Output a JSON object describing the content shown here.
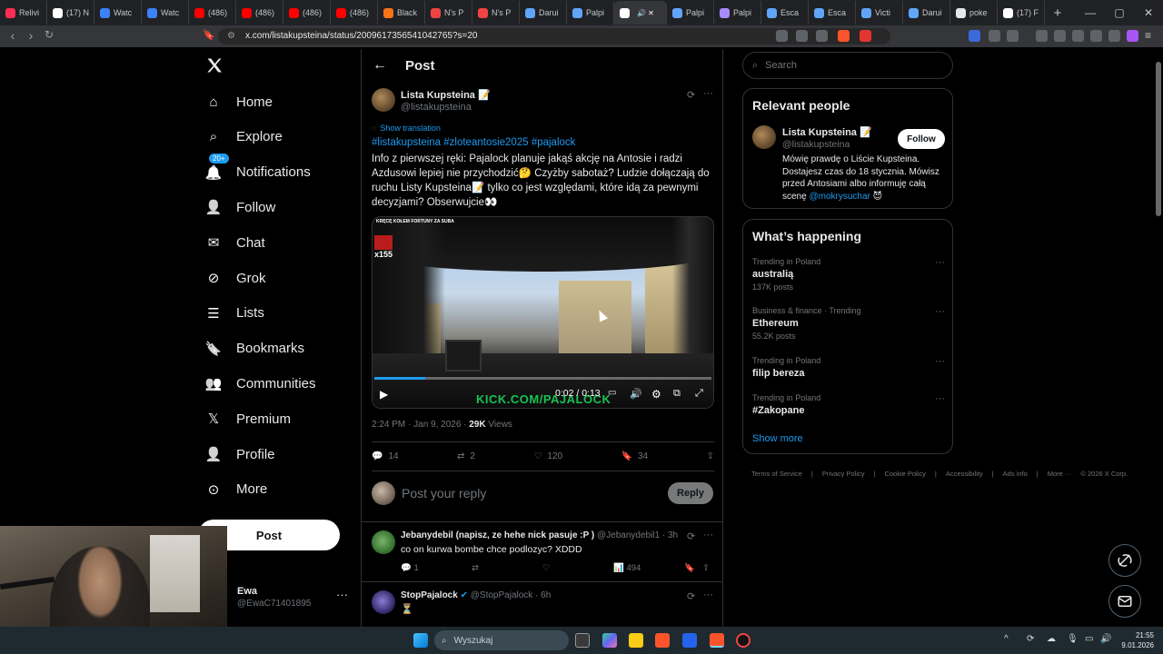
{
  "browser": {
    "tabs": [
      {
        "label": "Relivi",
        "color": "#ff2d55"
      },
      {
        "label": "(17) N",
        "color": "#ffffff"
      },
      {
        "label": "Watc",
        "color": "#3b82f6"
      },
      {
        "label": "Watc",
        "color": "#3b82f6"
      },
      {
        "label": "(486)",
        "color": "#ff0000"
      },
      {
        "label": "(486)",
        "color": "#ff0000"
      },
      {
        "label": "(486)",
        "color": "#ff0000"
      },
      {
        "label": "(486)",
        "color": "#ff0000"
      },
      {
        "label": "Black",
        "color": "#f97316"
      },
      {
        "label": "N's P",
        "color": "#ef4444"
      },
      {
        "label": "N's P",
        "color": "#ef4444"
      },
      {
        "label": "Darui",
        "color": "#60a5fa"
      },
      {
        "label": "Palpi",
        "color": "#60a5fa"
      },
      {
        "label": "",
        "color": "#ffffff"
      },
      {
        "label": "Palpi",
        "color": "#60a5fa"
      },
      {
        "label": "Palpi",
        "color": "#a78bfa"
      },
      {
        "label": "Esca",
        "color": "#60a5fa"
      },
      {
        "label": "Esca",
        "color": "#60a5fa"
      },
      {
        "label": "Victi",
        "color": "#60a5fa"
      },
      {
        "label": "Darui",
        "color": "#60a5fa"
      },
      {
        "label": "poke",
        "color": "#e5e7eb"
      },
      {
        "label": "(17) F",
        "color": "#ffffff"
      }
    ],
    "url": "x.com/listakupsteina/status/2009617356541042765?s=20"
  },
  "nav": {
    "items": [
      {
        "label": "Home",
        "icon": "home-icon"
      },
      {
        "label": "Explore",
        "icon": "search-icon"
      },
      {
        "label": "Notifications",
        "icon": "bell-icon"
      },
      {
        "label": "Follow",
        "icon": "add-person-icon"
      },
      {
        "label": "Chat",
        "icon": "mail-icon"
      },
      {
        "label": "Grok",
        "icon": "grok-icon"
      },
      {
        "label": "Lists",
        "icon": "list-icon"
      },
      {
        "label": "Bookmarks",
        "icon": "bookmark-icon"
      },
      {
        "label": "Communities",
        "icon": "communities-icon"
      },
      {
        "label": "Premium",
        "icon": "x-icon"
      },
      {
        "label": "Profile",
        "icon": "person-icon"
      },
      {
        "label": "More",
        "icon": "more-circle-icon"
      }
    ],
    "notifications_badge": "20+",
    "post_label": "Post",
    "user": {
      "name": "Ewa",
      "handle": "@EwaC71401895"
    }
  },
  "main": {
    "header_title": "Post",
    "tweet": {
      "author_name": "Lista Kupsteina 📝",
      "author_handle": "@listakupsteina",
      "show_translation": "Show translation",
      "hashtags": "#listakupsteina #zloteantosie2025 #pajalock",
      "text": "Info z pierwszej ręki: Pajalock planuje jakąś akcję na Antosie i radzi Azdusowi lepiej nie przychodzić🤔 Czyżby sabotaż? Ludzie dołączają do ruchu Listy Kupsteina📝 tylko co jest względami, które idą za pewnymi decyzjami? Obserwujcie👀",
      "video": {
        "overlay_text": "KRĘCĘ KOŁEM FORTUNY ZA SUBA",
        "overlay_count": "x155",
        "watermark": "KICK.COM/PAJALOCK",
        "time": "0:02 / 0:13",
        "progress": 0.15
      },
      "timestamp": "2:24 PM · Jan 9, 2026 · ",
      "views": "29K",
      "views_label": " Views",
      "stats": {
        "replies": "14",
        "reposts": "2",
        "likes": "120",
        "bookmarks": "34"
      }
    },
    "reply_placeholder": "Post your reply",
    "reply_button": "Reply",
    "replies": [
      {
        "name": "Jebanydebil (napisz, ze hehe nick pasuje :P )",
        "handle": "@Jebanydebil1 · 3h",
        "text": "co on kurwa bombe chce podlozyc? XDDD",
        "replies": "1",
        "views": "494"
      },
      {
        "name": "StopPajalock",
        "handle": "@StopPajalock · 6h",
        "text": "⏳"
      }
    ]
  },
  "right": {
    "search_placeholder": "Search",
    "relevant_title": "Relevant people",
    "relevant": {
      "name": "Lista Kupsteina 📝",
      "handle": "@listakupsteina",
      "follow_label": "Follow",
      "bio": "Mówię prawdę o Liście Kupsteina. Dostajesz czas do 18 stycznia. Mówisz przed Antosiami albo informuję całą scenę ",
      "bio_mention": "@mokrysuchar",
      "bio_end": " 😈"
    },
    "happening_title": "What’s happening",
    "trends": [
      {
        "category": "Trending in Poland",
        "name": "australią",
        "posts": "137K posts"
      },
      {
        "category": "Business & finance · Trending",
        "name": "Ethereum",
        "posts": "55.2K posts"
      },
      {
        "category": "Trending in Poland",
        "name": "filip bereza",
        "posts": ""
      },
      {
        "category": "Trending in Poland",
        "name": "#Zakopane",
        "posts": ""
      }
    ],
    "show_more": "Show more",
    "footer": [
      "Terms of Service",
      "|",
      "Privacy Policy",
      "|",
      "Cookie Policy",
      "|",
      "Accessibility",
      "|",
      "Ads info",
      "|",
      "More ···",
      "© 2026 X Corp."
    ]
  },
  "taskbar": {
    "search_placeholder": "Wyszukaj",
    "time": "21:55",
    "date": "9.01.2026"
  }
}
